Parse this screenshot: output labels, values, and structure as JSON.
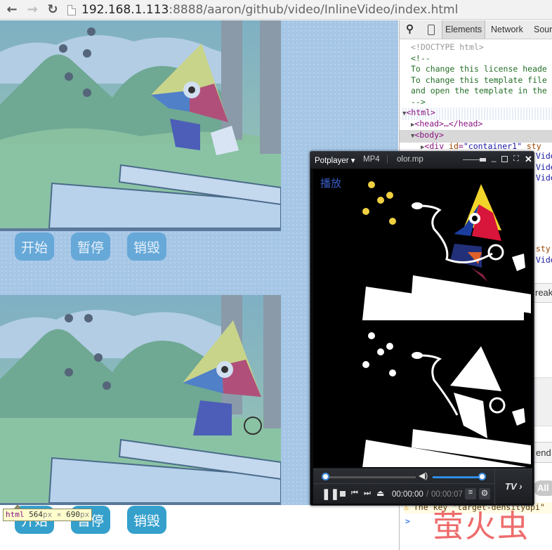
{
  "browser": {
    "url_host": "192.168.1.113",
    "url_rest": ":8888/aaron/github/video/InlineVideo/index.html",
    "back_icon": "arrow-left-icon",
    "forward_icon": "arrow-right-icon",
    "reload_icon": "reload-icon"
  },
  "page": {
    "players": [
      {
        "buttons": [
          "开始",
          "暂停",
          "销毁"
        ]
      },
      {
        "buttons": [
          "开始",
          "暂停",
          "销毁"
        ]
      }
    ],
    "inspect_tooltip": {
      "tag": "html",
      "width": "564",
      "height": "690",
      "unit": "px",
      "sep": "×"
    }
  },
  "devtools": {
    "tabs": [
      "Elements",
      "Network",
      "Sour"
    ],
    "active_tab": "Elements",
    "lines": [
      {
        "text": "<!DOCTYPE html>",
        "cls": "c-gray"
      },
      {
        "text": "<!--",
        "cls": "c-green"
      },
      {
        "text": "To change this license heade",
        "cls": "c-green"
      },
      {
        "text": "To change this template file",
        "cls": "c-green"
      },
      {
        "text": "and open the template in the",
        "cls": "c-green"
      },
      {
        "text": "-->",
        "cls": "c-green"
      }
    ],
    "html_tag": "<html>",
    "head_tag": "<head>…</head>",
    "body_tag": "<body>",
    "div_line": {
      "open": "<div ",
      "attr": "id",
      "val": "\"container1\"",
      "rest": " sty"
    },
    "partial_right": [
      "Vide",
      "Vide",
      "Vide",
      "sty",
      "Vide",
      "reak",
      "end",
      "All"
    ],
    "console_warning": "The key \"target-densitydpi\"",
    "console_prompt": ">"
  },
  "potplayer": {
    "app_name": "Potplayer ▾",
    "format": "MP4",
    "file_name": "olor.mp",
    "overlay_text": "播放",
    "time_current": "00:00:00",
    "time_separator": "/",
    "time_total": "00:00:07",
    "tv_label": "TV",
    "seek_progress": 0.0,
    "volume_level": 0.85
  },
  "watermark": "萤火虫"
}
